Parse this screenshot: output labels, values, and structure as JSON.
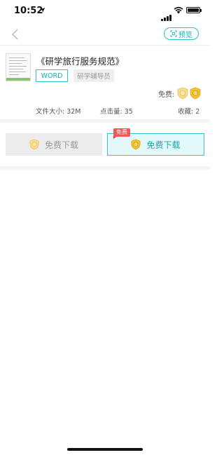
{
  "status_bar": {
    "time": "10:52",
    "icons": [
      "location-arrow-icon",
      "signal-icon",
      "wifi-icon",
      "battery-icon"
    ]
  },
  "nav": {
    "back_icon": "chevron-left-icon",
    "preview_label": "预览",
    "preview_icon": "scan-icon"
  },
  "document": {
    "title": "《研学旅行服务规范》",
    "format_tag": "WORD",
    "category_tag": "研学辅导员",
    "free_label": "免费:",
    "badges": [
      "silver-coin-shield-icon",
      "gold-coin-shield-icon"
    ],
    "file_size_label": "文件大小: 32M",
    "clicks_label": "点击量: 35",
    "favorites_label": "收藏: 2"
  },
  "download": {
    "left_button_label": "免费下载",
    "right_button_label": "免费下载",
    "right_ribbon": "免费"
  },
  "colors": {
    "accent": "#26c6c6",
    "accent_text": "#1aaeae",
    "ribbon_red": "#f0595a",
    "gold": "#f2c230"
  }
}
